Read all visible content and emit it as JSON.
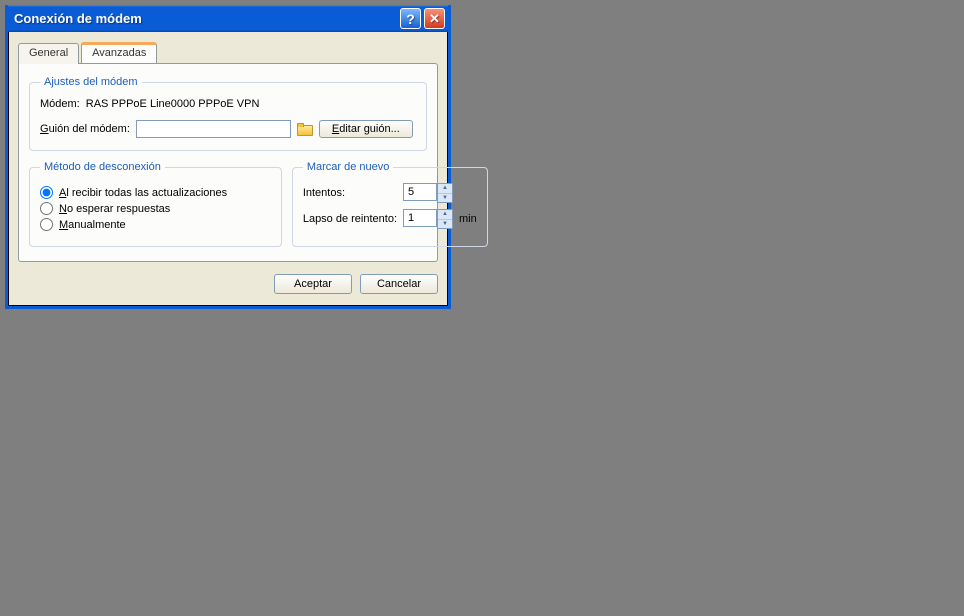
{
  "title": "Conexión de módem",
  "tabs": {
    "general": "General",
    "advanced": "Avanzadas"
  },
  "settings_group": {
    "legend": "Ajustes del módem",
    "modem_label": "Módem:",
    "modem_value": "RAS PPPoE Line0000 PPPoE VPN",
    "script_label_pre": "G",
    "script_label_post": "uión del módem:",
    "script_value": "",
    "edit_btn_pre": "E",
    "edit_btn_post": "ditar guión..."
  },
  "disconnect_group": {
    "legend": "Método de desconexión",
    "opt_all_pre": "A",
    "opt_all_post": "l recibir todas las actualizaciones",
    "opt_nowait_pre": "N",
    "opt_nowait_post": "o esperar respuestas",
    "opt_manual_pre": "M",
    "opt_manual_post": "anualmente"
  },
  "redial_group": {
    "legend": "Marcar de nuevo",
    "attempts_label": "Intentos:",
    "attempts_value": "5",
    "interval_label": "Lapso de reintento:",
    "interval_value": "1",
    "min_label": "min"
  },
  "buttons": {
    "ok": "Aceptar",
    "cancel": "Cancelar"
  }
}
